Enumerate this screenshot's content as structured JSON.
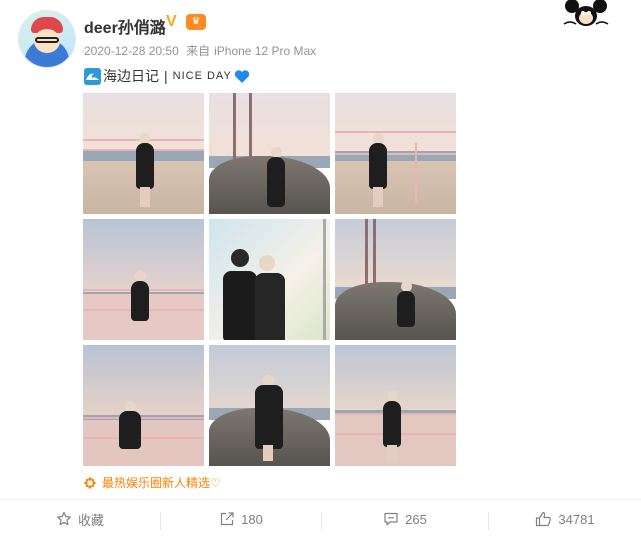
{
  "post": {
    "username": "deer孙俏潞",
    "verified_mark": "V",
    "meta": {
      "datetime": "2020-12-28 20:50",
      "source_prefix": "来自",
      "device": "iPhone 12 Pro Max"
    },
    "text": {
      "title": "海边日记",
      "separator": "|",
      "tagline": "NICE DAY"
    },
    "topic_tag": "最热娱乐圈新人精选♡"
  },
  "actions": {
    "favorite_label": "收藏",
    "repost_count": "180",
    "comment_count": "265",
    "like_count": "34781"
  },
  "colors": {
    "accent_orange": "#ff8200",
    "verified_gold": "#f5a623",
    "meta_gray": "#939393",
    "heart_blue": "#1f8ceb"
  },
  "icons": {
    "wave": "wave-emoji-icon",
    "heart": "blue-heart-icon",
    "star": "star-icon",
    "repost": "share-icon",
    "comment": "comment-icon",
    "like": "thumbs-up-icon"
  }
}
